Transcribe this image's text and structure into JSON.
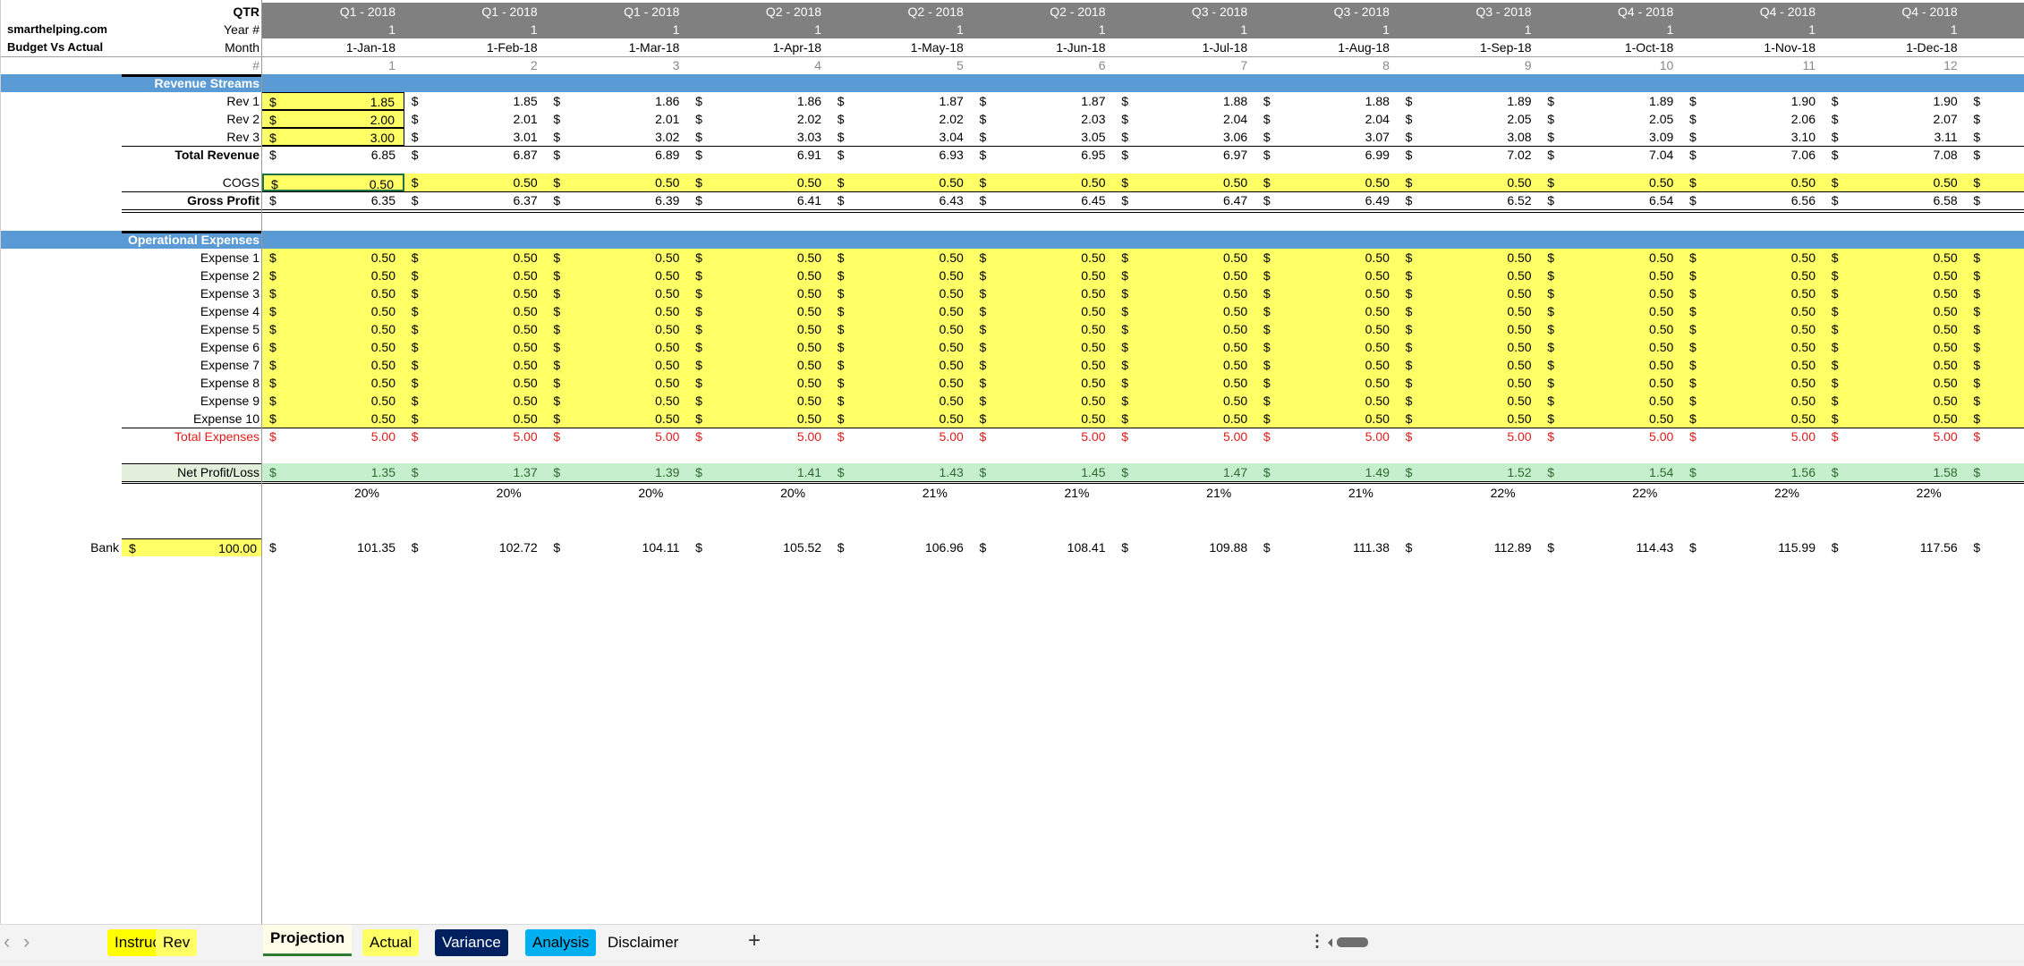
{
  "sheet": {
    "brand": "smarthelping.com",
    "subtitle": "Budget Vs Actual",
    "labels": {
      "qtr": "QTR",
      "year": "Year #",
      "month": "Month",
      "num": "#"
    },
    "currency": "$",
    "columns": [
      {
        "qtr": "Q1 - 2018",
        "year": "1",
        "month": "1-Jan-18",
        "num": "1"
      },
      {
        "qtr": "Q1 - 2018",
        "year": "1",
        "month": "1-Feb-18",
        "num": "2"
      },
      {
        "qtr": "Q1 - 2018",
        "year": "1",
        "month": "1-Mar-18",
        "num": "3"
      },
      {
        "qtr": "Q2 - 2018",
        "year": "1",
        "month": "1-Apr-18",
        "num": "4"
      },
      {
        "qtr": "Q2 - 2018",
        "year": "1",
        "month": "1-May-18",
        "num": "5"
      },
      {
        "qtr": "Q2 - 2018",
        "year": "1",
        "month": "1-Jun-18",
        "num": "6"
      },
      {
        "qtr": "Q3 - 2018",
        "year": "1",
        "month": "1-Jul-18",
        "num": "7"
      },
      {
        "qtr": "Q3 - 2018",
        "year": "1",
        "month": "1-Aug-18",
        "num": "8"
      },
      {
        "qtr": "Q3 - 2018",
        "year": "1",
        "month": "1-Sep-18",
        "num": "9"
      },
      {
        "qtr": "Q4 - 2018",
        "year": "1",
        "month": "1-Oct-18",
        "num": "10"
      },
      {
        "qtr": "Q4 - 2018",
        "year": "1",
        "month": "1-Nov-18",
        "num": "11"
      },
      {
        "qtr": "Q4 - 2018",
        "year": "1",
        "month": "1-Dec-18",
        "num": "12"
      }
    ],
    "sections": {
      "revenue": "Revenue Streams",
      "opex": "Operational Expenses"
    },
    "rows": {
      "rev1": {
        "label": "Rev 1",
        "values": [
          "1.85",
          "1.85",
          "1.86",
          "1.86",
          "1.87",
          "1.87",
          "1.88",
          "1.88",
          "1.89",
          "1.89",
          "1.90",
          "1.90"
        ]
      },
      "rev2": {
        "label": "Rev 2",
        "values": [
          "2.00",
          "2.01",
          "2.01",
          "2.02",
          "2.02",
          "2.03",
          "2.04",
          "2.04",
          "2.05",
          "2.05",
          "2.06",
          "2.07"
        ]
      },
      "rev3": {
        "label": "Rev 3",
        "values": [
          "3.00",
          "3.01",
          "3.02",
          "3.03",
          "3.04",
          "3.05",
          "3.06",
          "3.07",
          "3.08",
          "3.09",
          "3.10",
          "3.11"
        ]
      },
      "total_revenue": {
        "label": "Total Revenue",
        "values": [
          "6.85",
          "6.87",
          "6.89",
          "6.91",
          "6.93",
          "6.95",
          "6.97",
          "6.99",
          "7.02",
          "7.04",
          "7.06",
          "7.08"
        ]
      },
      "cogs": {
        "label": "COGS",
        "values": [
          "0.50",
          "0.50",
          "0.50",
          "0.50",
          "0.50",
          "0.50",
          "0.50",
          "0.50",
          "0.50",
          "0.50",
          "0.50",
          "0.50"
        ]
      },
      "gross_profit": {
        "label": "Gross Profit",
        "values": [
          "6.35",
          "6.37",
          "6.39",
          "6.41",
          "6.43",
          "6.45",
          "6.47",
          "6.49",
          "6.52",
          "6.54",
          "6.56",
          "6.58"
        ]
      },
      "expenses": [
        {
          "label": "Expense 1",
          "values": [
            "0.50",
            "0.50",
            "0.50",
            "0.50",
            "0.50",
            "0.50",
            "0.50",
            "0.50",
            "0.50",
            "0.50",
            "0.50",
            "0.50"
          ]
        },
        {
          "label": "Expense 2",
          "values": [
            "0.50",
            "0.50",
            "0.50",
            "0.50",
            "0.50",
            "0.50",
            "0.50",
            "0.50",
            "0.50",
            "0.50",
            "0.50",
            "0.50"
          ]
        },
        {
          "label": "Expense 3",
          "values": [
            "0.50",
            "0.50",
            "0.50",
            "0.50",
            "0.50",
            "0.50",
            "0.50",
            "0.50",
            "0.50",
            "0.50",
            "0.50",
            "0.50"
          ]
        },
        {
          "label": "Expense 4",
          "values": [
            "0.50",
            "0.50",
            "0.50",
            "0.50",
            "0.50",
            "0.50",
            "0.50",
            "0.50",
            "0.50",
            "0.50",
            "0.50",
            "0.50"
          ]
        },
        {
          "label": "Expense 5",
          "values": [
            "0.50",
            "0.50",
            "0.50",
            "0.50",
            "0.50",
            "0.50",
            "0.50",
            "0.50",
            "0.50",
            "0.50",
            "0.50",
            "0.50"
          ]
        },
        {
          "label": "Expense 6",
          "values": [
            "0.50",
            "0.50",
            "0.50",
            "0.50",
            "0.50",
            "0.50",
            "0.50",
            "0.50",
            "0.50",
            "0.50",
            "0.50",
            "0.50"
          ]
        },
        {
          "label": "Expense 7",
          "values": [
            "0.50",
            "0.50",
            "0.50",
            "0.50",
            "0.50",
            "0.50",
            "0.50",
            "0.50",
            "0.50",
            "0.50",
            "0.50",
            "0.50"
          ]
        },
        {
          "label": "Expense 8",
          "values": [
            "0.50",
            "0.50",
            "0.50",
            "0.50",
            "0.50",
            "0.50",
            "0.50",
            "0.50",
            "0.50",
            "0.50",
            "0.50",
            "0.50"
          ]
        },
        {
          "label": "Expense 9",
          "values": [
            "0.50",
            "0.50",
            "0.50",
            "0.50",
            "0.50",
            "0.50",
            "0.50",
            "0.50",
            "0.50",
            "0.50",
            "0.50",
            "0.50"
          ]
        },
        {
          "label": "Expense 10",
          "values": [
            "0.50",
            "0.50",
            "0.50",
            "0.50",
            "0.50",
            "0.50",
            "0.50",
            "0.50",
            "0.50",
            "0.50",
            "0.50",
            "0.50"
          ]
        }
      ],
      "total_expenses": {
        "label": "Total Expenses",
        "values": [
          "5.00",
          "5.00",
          "5.00",
          "5.00",
          "5.00",
          "5.00",
          "5.00",
          "5.00",
          "5.00",
          "5.00",
          "5.00",
          "5.00"
        ]
      },
      "net_profit": {
        "label": "Net Profit/Loss",
        "values": [
          "1.35",
          "1.37",
          "1.39",
          "1.41",
          "1.43",
          "1.45",
          "1.47",
          "1.49",
          "1.52",
          "1.54",
          "1.56",
          "1.58"
        ]
      },
      "margin": {
        "values": [
          "20%",
          "20%",
          "20%",
          "20%",
          "21%",
          "21%",
          "21%",
          "21%",
          "22%",
          "22%",
          "22%",
          "22%"
        ]
      },
      "bank": {
        "label": "Bank",
        "opening": "100.00",
        "values": [
          "101.35",
          "102.72",
          "104.11",
          "105.52",
          "106.96",
          "108.41",
          "109.88",
          "111.38",
          "112.89",
          "114.43",
          "115.99",
          "117.56"
        ]
      }
    }
  },
  "tabs": [
    {
      "label": "Instruction",
      "bg": "#ffff00",
      "color": "#000000"
    },
    {
      "label": "Rev",
      "bg": "#ffff66",
      "color": "#000000"
    },
    {
      "label": "Projection",
      "bg": "#fffde8",
      "color": "#000000",
      "active": true
    },
    {
      "label": "Actual",
      "bg": "#ffff66",
      "color": "#000000"
    },
    {
      "label": "Variance",
      "bg": "#002060",
      "color": "#ffffff"
    },
    {
      "label": "Analysis",
      "bg": "#00b0f0",
      "color": "#000000"
    },
    {
      "label": "Disclaimer",
      "bg": "transparent",
      "color": "#000000"
    }
  ],
  "tabbar": {
    "add": "+",
    "prev": "‹",
    "next": "›",
    "menu": "⋮"
  },
  "colors": {
    "header_gray": "#808080",
    "section_blue": "#5b9bd5",
    "input_yellow": "#ffff66",
    "profit_green": "#c6efce",
    "expense_red": "#e01b1b",
    "active_tab_underline": "#2e7d32"
  }
}
